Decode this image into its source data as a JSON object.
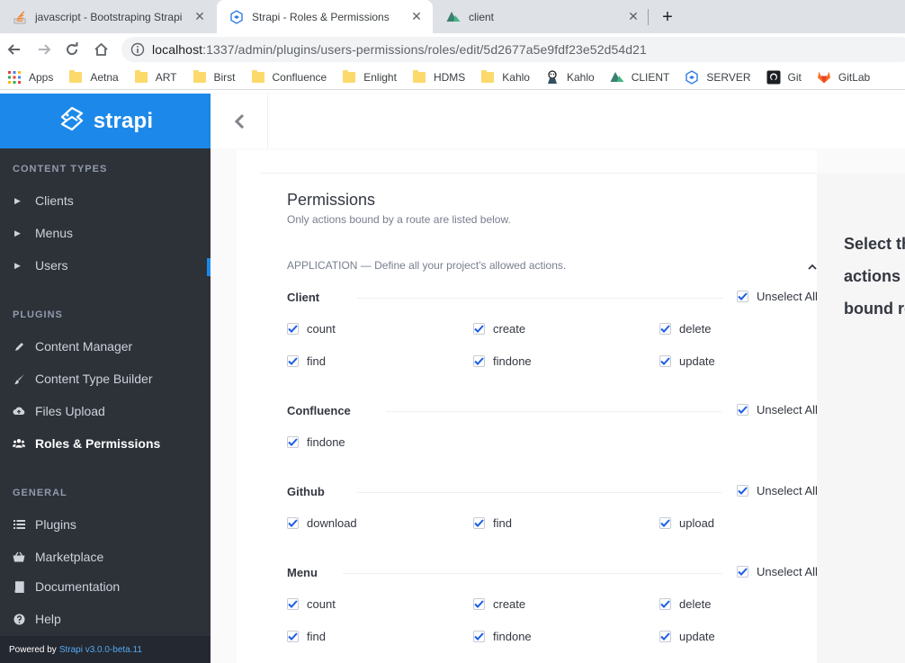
{
  "browser": {
    "tabs": [
      {
        "title": "javascript - Bootstraping Strapi R",
        "icon": "stackoverflow-icon"
      },
      {
        "title": "Strapi - Roles & Permissions",
        "icon": "strapi-icon",
        "active": true
      },
      {
        "title": "client",
        "icon": "nuxt-icon"
      }
    ],
    "url_host": "localhost",
    "url_rest": ":1337/admin/plugins/users-permissions/roles/edit/5d2677a5e9fdf23e52d54d21",
    "bookmarks": [
      {
        "label": "Apps",
        "icon": "apps-grid-icon"
      },
      {
        "label": "Aetna",
        "icon": "folder-icon"
      },
      {
        "label": "ART",
        "icon": "folder-icon"
      },
      {
        "label": "Birst",
        "icon": "folder-icon"
      },
      {
        "label": "Confluence",
        "icon": "folder-icon"
      },
      {
        "label": "Enlight",
        "icon": "folder-icon"
      },
      {
        "label": "HDMS",
        "icon": "folder-icon"
      },
      {
        "label": "Kahlo",
        "icon": "folder-icon"
      },
      {
        "label": "Kahlo",
        "icon": "jenkins-icon"
      },
      {
        "label": "CLIENT",
        "icon": "nuxt-icon"
      },
      {
        "label": "SERVER",
        "icon": "strapi-icon"
      },
      {
        "label": "Git",
        "icon": "github-icon"
      },
      {
        "label": "GitLab",
        "icon": "gitlab-icon"
      }
    ]
  },
  "sidebar": {
    "brand": "strapi",
    "sections": [
      {
        "title": "Content Types",
        "items": [
          "Clients",
          "Menus",
          "Users"
        ]
      },
      {
        "title": "Plugins",
        "items": [
          "Content Manager",
          "Content Type Builder",
          "Files Upload",
          "Roles & Permissions"
        ]
      },
      {
        "title": "General",
        "items": [
          "Plugins",
          "Marketplace",
          "Documentation",
          "Help"
        ]
      }
    ],
    "active_item": "Roles & Permissions",
    "powered_label": "Powered by",
    "powered_version": "Strapi v3.0.0-beta.11"
  },
  "permissions": {
    "title": "Permissions",
    "subtitle": "Only actions bound by a route are listed below.",
    "application_name": "Application",
    "application_desc": " — Define all your project's allowed actions.",
    "unselect_label": "Unselect All",
    "groups": [
      {
        "name": "Client",
        "actions": [
          "count",
          "create",
          "delete",
          "find",
          "findone",
          "update"
        ]
      },
      {
        "name": "Confluence",
        "actions": [
          "findone"
        ]
      },
      {
        "name": "Github",
        "actions": [
          "download",
          "find",
          "upload"
        ]
      },
      {
        "name": "Menu",
        "actions": [
          "count",
          "create",
          "delete",
          "find",
          "findone",
          "update"
        ]
      }
    ]
  },
  "right_panel": {
    "lines": [
      "Select th",
      "actions a",
      "bound ro"
    ]
  },
  "colors": {
    "sidebar_bg": "#2d3138",
    "brand_blue": "#1c89ea",
    "checkbox_check": "#1c5de7"
  }
}
